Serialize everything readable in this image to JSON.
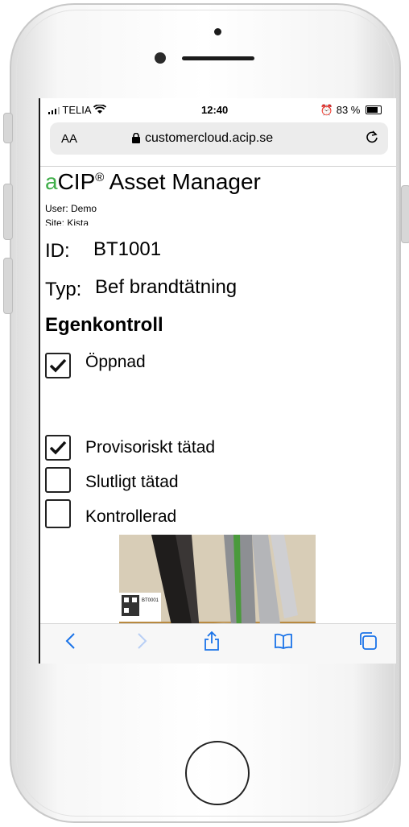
{
  "status_bar": {
    "carrier": "TELIA",
    "time": "12:40",
    "battery": "83 %"
  },
  "browser": {
    "text_size": "AA",
    "url": "customercloud.acip.se"
  },
  "app": {
    "brand_prefix": "a",
    "brand_main": "CIP",
    "brand_reg": "®",
    "brand_suffix": " Asset Manager"
  },
  "user_line": "User: Demo",
  "site_line": "Site: Kista",
  "id_label": "ID:",
  "id_value": "BT1001",
  "type_label": "Typ:",
  "type_value": "Bef brandtätning",
  "section_title": "Egenkontroll",
  "checks": [
    {
      "label": "Öppnad",
      "checked": true
    },
    {
      "label": "Provisoriskt tätad",
      "checked": true
    },
    {
      "label": "Slutligt tätad",
      "checked": false
    },
    {
      "label": "Kontrollerad",
      "checked": false
    }
  ],
  "photo": {
    "tag_text": "BT0001"
  },
  "colors": {
    "accent_green": "#3fae49",
    "ios_blue": "#1a73e8"
  },
  "icons": [
    "wifi-icon",
    "signal-icon",
    "alarm-icon",
    "battery-icon",
    "lock-icon",
    "reload-icon",
    "back-icon",
    "forward-icon",
    "share-icon",
    "bookmarks-icon",
    "tabs-icon"
  ]
}
